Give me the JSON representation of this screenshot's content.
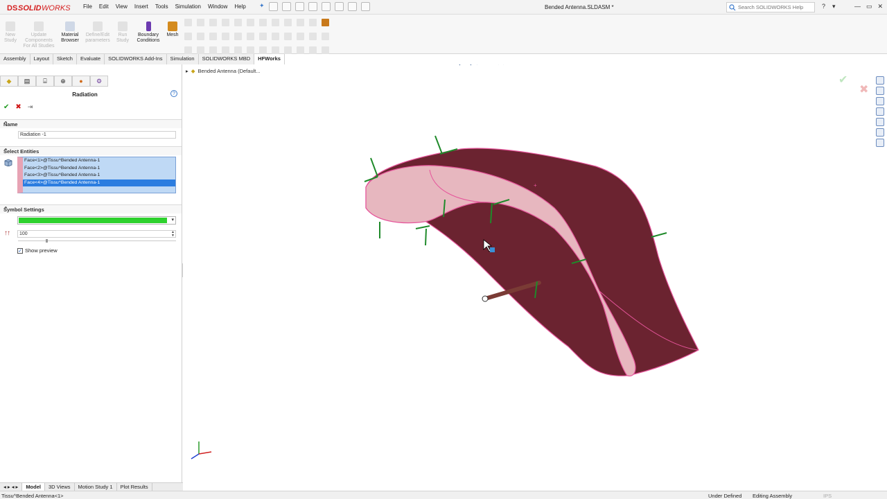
{
  "app": {
    "brand": "SOLIDWORKS",
    "document_title": "Bended Antenna.SLDASM *"
  },
  "menu": [
    "File",
    "Edit",
    "View",
    "Insert",
    "Tools",
    "Simulation",
    "Window",
    "Help"
  ],
  "search": {
    "placeholder": "Search SOLIDWORKS Help"
  },
  "ribbon": {
    "new_study": "New Study",
    "update": "Update Components For All Studies",
    "material": "Material Browser",
    "define": "Define/Edit parameters",
    "run": "Run Study",
    "boundary": "Boundary Conditions",
    "mesh": "Mesh"
  },
  "tabs": [
    "Assembly",
    "Layout",
    "Sketch",
    "Evaluate",
    "SOLIDWORKS Add-Ins",
    "Simulation",
    "SOLIDWORKS MBD",
    "HFWorks"
  ],
  "active_tab": "HFWorks",
  "panel": {
    "title": "Radiation",
    "help": "?",
    "name_section": "Name",
    "name_value": "Radiation -1",
    "select_section": "Select Entities",
    "faces": [
      "Face<1>@Tissu^Bended Antenna-1",
      "Face<2>@Tissu^Bended Antenna-1",
      "Face<3>@Tissu^Bended Antenna-1",
      "Face<4>@Tissu^Bended Antenna-1"
    ],
    "selected_face_index": 3,
    "symbol_section": "Symbol Settings",
    "symbol_color": "#2dd12d",
    "symbol_size": "100",
    "show_preview": "Show preview",
    "show_preview_checked": true
  },
  "viewport": {
    "tree_root": "Bended Antenna (Default..."
  },
  "bottom_tabs": [
    "Model",
    "3D Views",
    "Motion Study 1",
    "Plot Results"
  ],
  "status": {
    "left": "Tissu^Bended Antenna<1>",
    "state": "Under Defined",
    "mode": "Editing Assembly",
    "units": "IPS"
  },
  "colors": {
    "model_dark": "#6b2330",
    "model_light": "#e7b7bf",
    "edge": "#e6559b",
    "arrow": "#1f8a2a"
  },
  "icons": [
    "search-icon",
    "help-icon",
    "check-icon",
    "close-icon",
    "pin-icon",
    "face-icon",
    "arrow-size-icon"
  ]
}
